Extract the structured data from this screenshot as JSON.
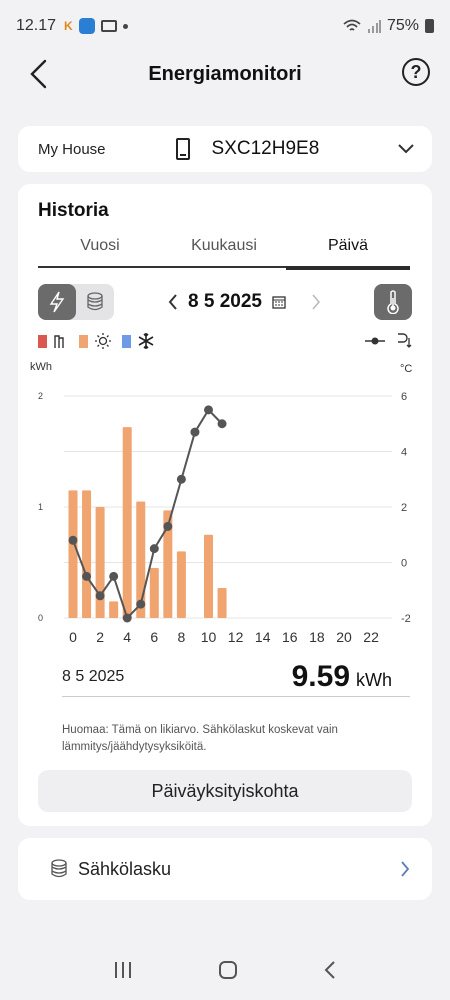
{
  "status_bar": {
    "time": "12.17",
    "battery": "75%",
    "notif_k": "K"
  },
  "header": {
    "title": "Energiamonitori"
  },
  "device": {
    "house": "My House",
    "model": "SXC12H9E8"
  },
  "history": {
    "title": "Historia",
    "tabs": [
      "Vuosi",
      "Kuukausi",
      "Päivä"
    ],
    "active_tab": "Päivä",
    "date": "8 5 2025"
  },
  "legend": {
    "heating_color": "#d9584f",
    "hotwater_color": "#f0a470",
    "cooling_color": "#6f9ae8"
  },
  "chart_data": {
    "type": "bar",
    "ylabel_left": "kWh",
    "ylabel_right": "°C",
    "y_left_ticks": [
      "2",
      "1",
      "0"
    ],
    "y_right_ticks": [
      "6",
      "4",
      "2",
      "0",
      "-2"
    ],
    "ylim_left": [
      0,
      2
    ],
    "ylim_right": [
      -2,
      6
    ],
    "x_ticks": [
      "0",
      "2",
      "4",
      "6",
      "8",
      "10",
      "12",
      "14",
      "16",
      "18",
      "20",
      "22"
    ],
    "bar_color": "#f0a470",
    "line_color": "#555555",
    "series": [
      {
        "values": [
          1.15,
          1.15,
          1.0,
          0.15,
          1.72,
          1.05,
          0.45,
          0.97,
          0.6,
          0,
          0.75,
          0.27,
          0,
          0,
          0,
          0,
          0,
          0,
          0,
          0,
          0,
          0,
          0,
          0
        ]
      },
      {
        "values": [
          0.8,
          -0.5,
          -1.2,
          -0.5,
          -2.0,
          -1.5,
          0.5,
          1.3,
          3.0,
          4.7,
          5.5,
          5.0,
          null,
          null,
          null,
          null,
          null,
          null,
          null,
          null,
          null,
          null,
          null,
          null
        ]
      }
    ]
  },
  "summary": {
    "date": "8 5 2025",
    "value": "9.59",
    "unit": "kWh",
    "note": "Huomaa: Tämä on likiarvo. Sähkölaskut koskevat vain lämmitys/jäähdytysyksiköitä."
  },
  "buttons": {
    "detail": "Päiväyksityiskohta",
    "bill": "Sähkölasku"
  }
}
